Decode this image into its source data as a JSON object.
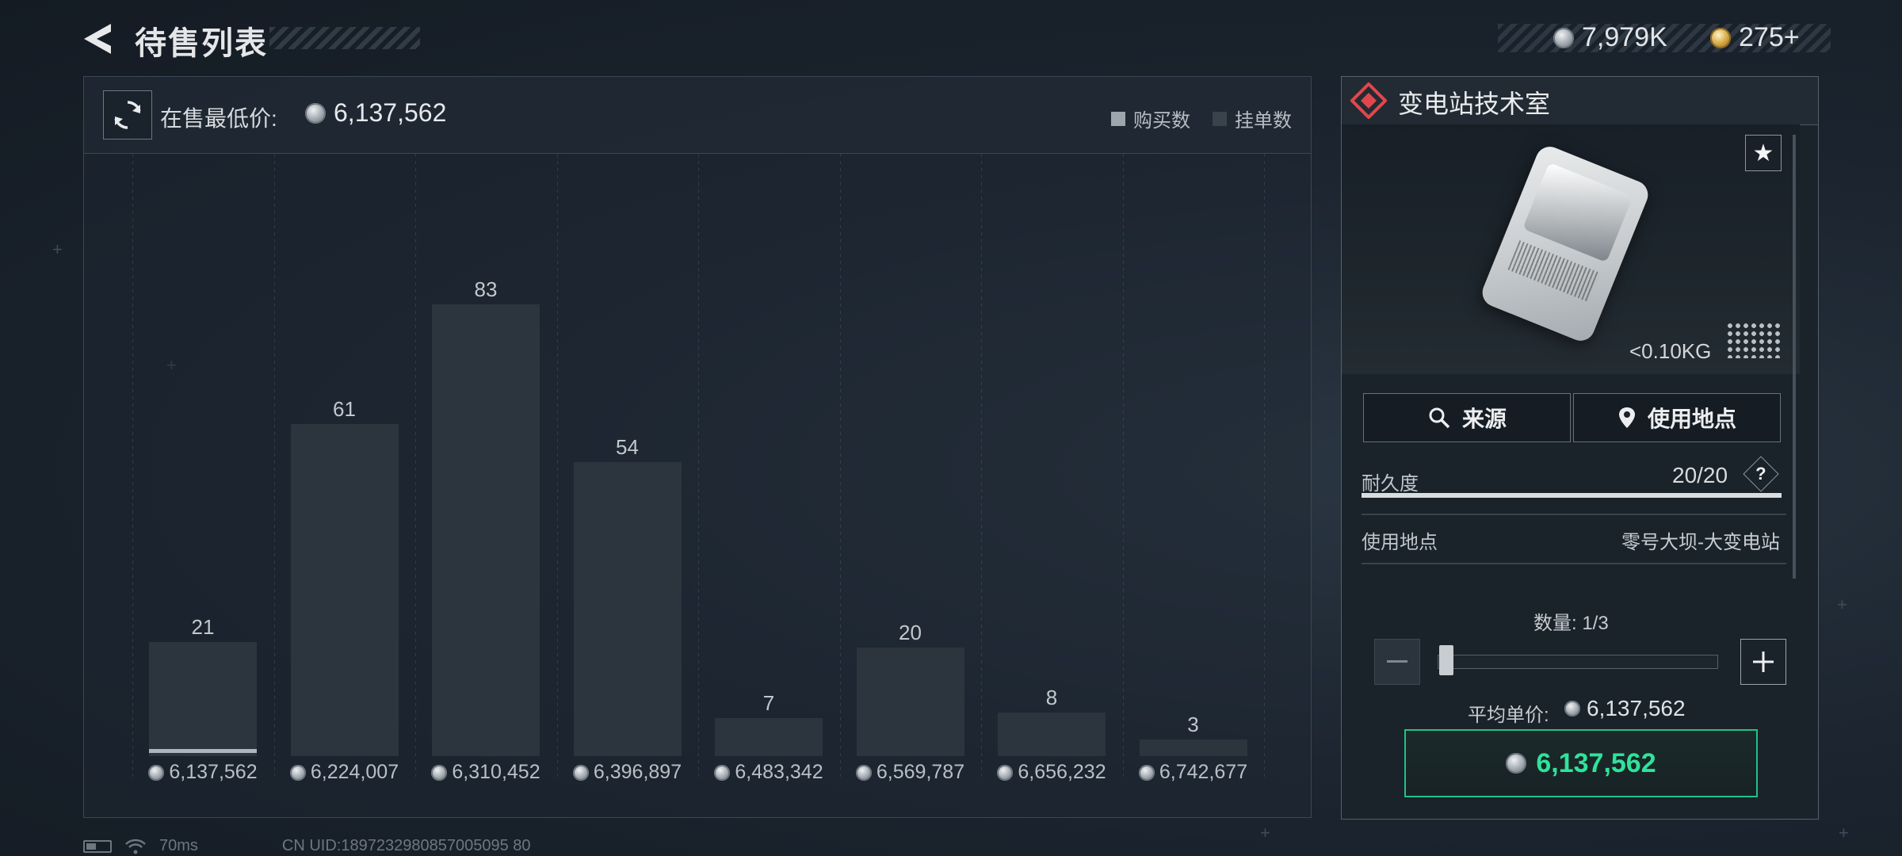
{
  "header": {
    "title": "待售列表",
    "currency_silver": "7,979K",
    "currency_gold": "275+"
  },
  "market": {
    "lowest_label": "在售最低价:",
    "lowest_price": "6,137,562",
    "legend_buy": "购买数",
    "legend_list": "挂单数"
  },
  "chart_data": {
    "type": "bar",
    "categories": [
      "6,137,562",
      "6,224,007",
      "6,310,452",
      "6,396,897",
      "6,483,342",
      "6,569,787",
      "6,656,232",
      "6,742,677"
    ],
    "series": [
      {
        "name": "挂单数",
        "values": [
          21,
          61,
          83,
          54,
          7,
          20,
          8,
          3
        ]
      }
    ],
    "value_labels": [
      "21",
      "61",
      "83",
      "54",
      "7",
      "20",
      "8",
      "3"
    ],
    "ylim": [
      0,
      83
    ]
  },
  "status": {
    "ping": "70ms",
    "uid": "CN UID:1897232980857005095 80"
  },
  "item": {
    "name": "变电站技术室",
    "weight": "<0.10KG",
    "source_label": "来源",
    "use_location_label": "使用地点",
    "durability_label": "耐久度",
    "durability_value": "20/20",
    "durability_fraction": 1.0,
    "location_label": "使用地点",
    "location_value": "零号大坝-大变电站"
  },
  "purchase": {
    "quantity_label": "数量: 1/3",
    "quantity_fraction": 0.0,
    "avg_label": "平均单价:",
    "avg_value": "6,137,562",
    "buy_value": "6,137,562"
  },
  "colors": {
    "accent_green": "#2fe39a",
    "accent_red": "#e0474c",
    "bar": "#2c353e"
  }
}
